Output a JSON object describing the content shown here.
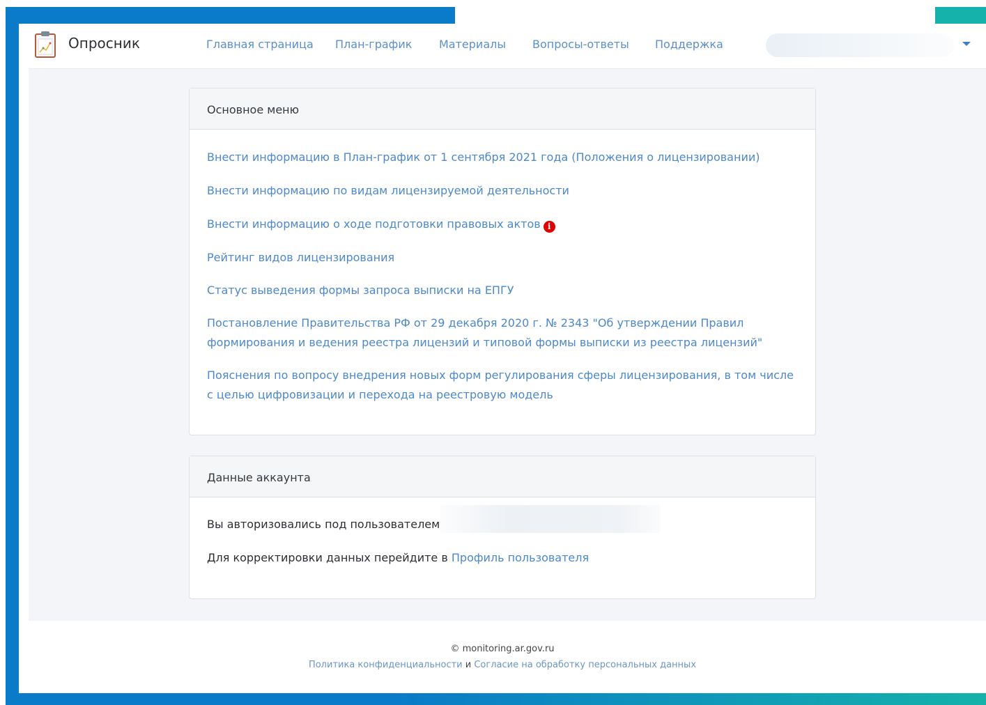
{
  "app": {
    "title": "Опросник",
    "icon": "clipboard-chart-icon"
  },
  "nav": {
    "items": [
      {
        "label": "Главная страница"
      },
      {
        "label": "План-график"
      },
      {
        "label": "Материалы"
      },
      {
        "label": "Вопросы-ответы"
      },
      {
        "label": "Поддержка"
      }
    ],
    "user_menu_icon": "caret-down-icon"
  },
  "main_menu": {
    "title": "Основное меню",
    "links": [
      {
        "label": "Внести информацию в План-график от 1 сентября 2021 года (Положения о лицензировании)"
      },
      {
        "label": "Внести информацию по видам лицензируемой деятельности"
      },
      {
        "label": "Внести информацию о ходе подготовки правовых актов",
        "badge_icon": "info-alert-icon",
        "badge_text": "i"
      },
      {
        "label": "Рейтинг видов лицензирования"
      },
      {
        "label": "Статус выведения формы запроса выписки на ЕПГУ"
      },
      {
        "label": "Постановление Правительства РФ от 29 декабря 2020 г. № 2343 \"Об утверждении Правил формирования и ведения реестра лицензий и типовой формы выписки из реестра лицензий\""
      },
      {
        "label": "Пояснения по вопросу внедрения новых форм регулирования сферы лицензирования, в том числе с целью цифровизации и перехода на реестровую модель"
      }
    ]
  },
  "account": {
    "title": "Данные аккаунта",
    "authorized_text": "Вы авторизовались под пользователем",
    "edit_text": "Для корректировки данных перейдите в",
    "profile_link": "Профиль пользователя"
  },
  "footer": {
    "copyright": "© monitoring.ar.gov.ru",
    "privacy_link": "Политика конфиденциальности",
    "conjunction": "и",
    "consent_link": "Согласие на обработку персональных данных"
  },
  "colors": {
    "frame_blue": "#0a7bc8",
    "frame_teal": "#14b2aa",
    "link": "#4d88c8",
    "alert": "#e00000"
  }
}
